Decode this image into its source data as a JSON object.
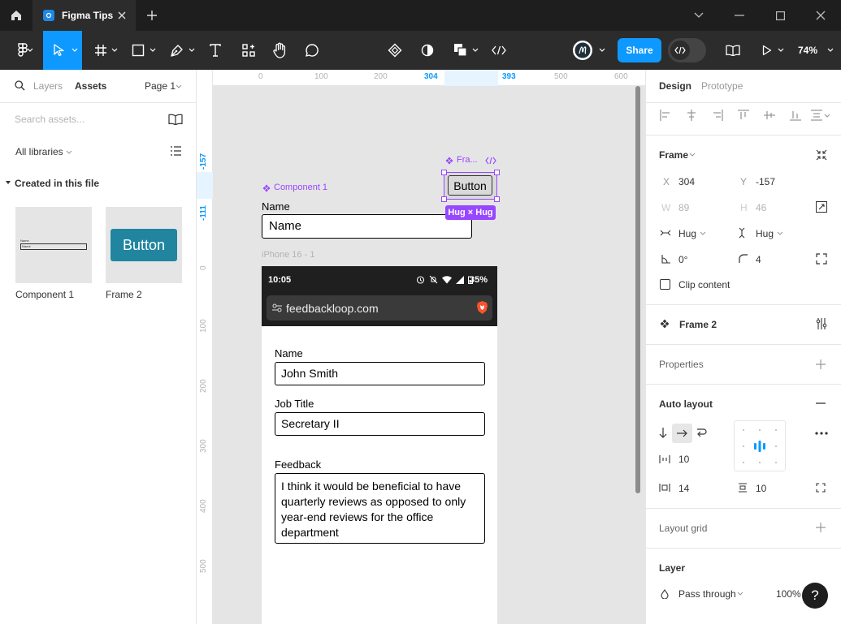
{
  "tab": {
    "title": "Figma Tips"
  },
  "toolbar": {
    "share_label": "Share",
    "zoom": "74%"
  },
  "left_panel": {
    "tabs": [
      {
        "label": "Layers"
      },
      {
        "label": "Assets"
      }
    ],
    "page": "Page 1",
    "search_placeholder": "Search assets...",
    "libraries": "All libraries",
    "section": "Created in this file",
    "assets": [
      {
        "label": "Component 1",
        "mini_top": "Name",
        "mini_field": "Name"
      },
      {
        "label": "Frame 2",
        "button_text": "Button"
      }
    ]
  },
  "canvas": {
    "ruler_top": [
      "0",
      "100",
      "200",
      "304",
      "393",
      "500",
      "600"
    ],
    "ruler_left": [
      "-157",
      "-111",
      "0",
      "100",
      "200",
      "300",
      "400",
      "500"
    ],
    "component": {
      "label": "Component 1",
      "field_label": "Name",
      "field_value": "Name"
    },
    "frame": {
      "label": "Fra...",
      "button": "Button",
      "size_badge": "Hug × Hug"
    },
    "iphone": {
      "label": "iPhone 16 - 1",
      "time": "10:05",
      "battery": "35%",
      "url": "feedbackloop.com",
      "fields": [
        {
          "label": "Name",
          "value": "John Smith"
        },
        {
          "label": "Job Title",
          "value": "Secretary II"
        }
      ],
      "feedback_label": "Feedback",
      "feedback_lines": [
        "I think it would be beneficial to have",
        "quarterly reviews as opposed to only",
        "year-end reviews for the office",
        "department"
      ]
    }
  },
  "right_panel": {
    "tabs": [
      {
        "label": "Design"
      },
      {
        "label": "Prototype"
      }
    ],
    "frame": {
      "title": "Frame",
      "x_label": "X",
      "x": "304",
      "y_label": "Y",
      "y": "-157",
      "w_label": "W",
      "w": "89",
      "h_label": "H",
      "h": "46",
      "hug_w": "Hug",
      "hug_h": "Hug",
      "rotation": "0°",
      "radius": "4",
      "clip_label": "Clip content"
    },
    "instance": {
      "name": "Frame 2"
    },
    "properties": {
      "title": "Properties"
    },
    "auto_layout": {
      "title": "Auto layout",
      "gap": "10",
      "padding_h": "14",
      "padding_v": "10"
    },
    "layout_grid": {
      "title": "Layout grid"
    },
    "layer": {
      "title": "Layer",
      "blend": "Pass through",
      "opacity": "100%"
    }
  },
  "colors": {
    "accent": "#0d99ff",
    "component": "#9747ff",
    "selection_badge": "#9747ff",
    "toolbar": "#2c2c2c",
    "titlebar": "#1e1e1e"
  }
}
